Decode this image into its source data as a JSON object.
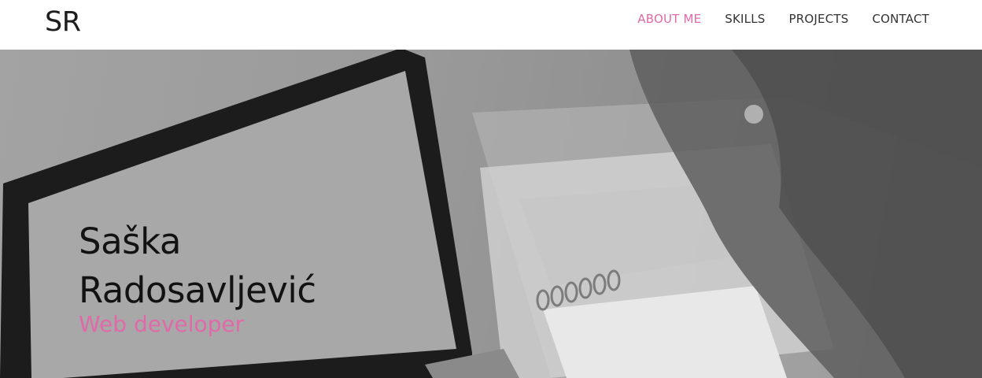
{
  "brand": {
    "logo_text": "SR"
  },
  "nav": {
    "items": [
      {
        "label": "ABOUT ME",
        "active": true
      },
      {
        "label": "SKILLS",
        "active": false
      },
      {
        "label": "PROJECTS",
        "active": false
      },
      {
        "label": "CONTACT",
        "active": false
      }
    ]
  },
  "hero": {
    "name_first": "Saška",
    "name_last": "Radosavljević",
    "role": "Web developer"
  },
  "colors": {
    "accent": "#e06aa8",
    "text_dark": "#121212",
    "nav_text": "#333333",
    "background": "#ffffff"
  }
}
